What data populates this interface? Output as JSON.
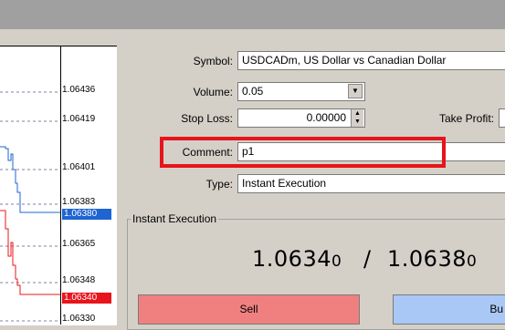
{
  "chart": {
    "ticks": [
      "1.06436",
      "1.06419",
      "1.06401",
      "1.06383",
      "1.06365",
      "1.06348",
      "1.06330"
    ],
    "ask_price": "1.06380",
    "bid_price": "1.06340",
    "colors": {
      "ask": "#1e64d2",
      "bid": "#e8141b",
      "grid": "#8080a0"
    }
  },
  "form": {
    "symbol_label": "Symbol:",
    "symbol_value": "USDCADm, US Dollar vs Canadian Dollar",
    "volume_label": "Volume:",
    "volume_value": "0.05",
    "stoploss_label": "Stop Loss:",
    "stoploss_value": "0.00000",
    "takeprofit_label": "Take Profit:",
    "comment_label": "Comment:",
    "comment_value": "p1",
    "type_label": "Type:",
    "type_value": "Instant Execution"
  },
  "execution": {
    "group_label": "Instant Execution",
    "bid": "1.0634",
    "bid_small": "0",
    "separator": "/",
    "ask": "1.0638",
    "ask_small": "0",
    "sell_label": "Sell",
    "buy_label": "Bu"
  },
  "colors": {
    "highlight": "#e8141b",
    "sell": "#f08080",
    "buy": "#a9c8f5"
  }
}
